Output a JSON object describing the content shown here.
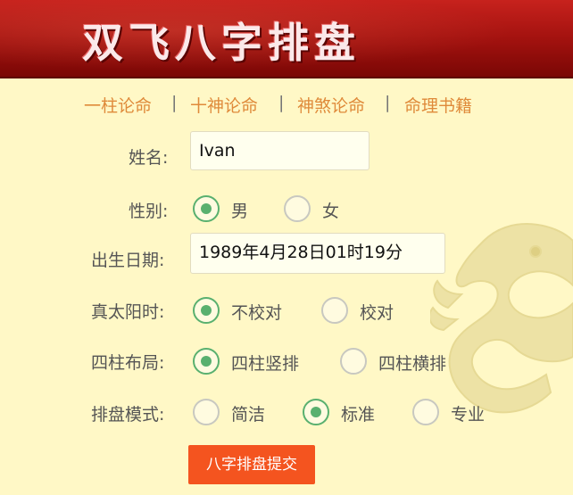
{
  "header": {
    "title": "双飞八字排盘"
  },
  "nav": {
    "items": [
      "一柱论命",
      "十神论命",
      "神煞论命",
      "命理书籍"
    ],
    "separator": "|"
  },
  "form": {
    "name_label": "姓名:",
    "name_value": "Ivan",
    "gender_label": "性别:",
    "gender_options": [
      "男",
      "女"
    ],
    "gender_selected": "男",
    "birth_label": "出生日期:",
    "birth_value": "1989年4月28日01时19分",
    "solar_label": "真太阳时:",
    "solar_options": [
      "不校对",
      "校对"
    ],
    "solar_selected": "不校对",
    "layout_label": "四柱布局:",
    "layout_options": [
      "四柱竖排",
      "四柱横排"
    ],
    "layout_selected": "四柱竖排",
    "mode_label": "排盘模式:",
    "mode_options": [
      "简洁",
      "标准",
      "专业"
    ],
    "mode_selected": "标准",
    "submit_label": "八字排盘提交"
  },
  "colors": {
    "banner": "#a3120f",
    "background": "#fff8c6",
    "nav_link": "#df8a3a",
    "radio_checked": "#59b06f",
    "submit": "#f4541f"
  },
  "icons": {
    "decoration": "dragon-watermark"
  }
}
